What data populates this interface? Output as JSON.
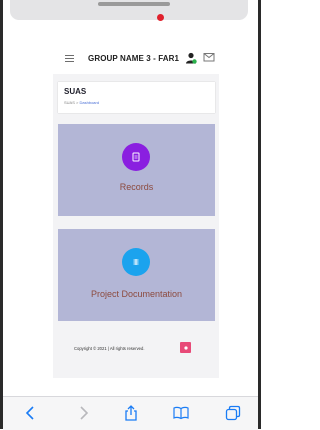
{
  "topbar": {
    "group_name": "GROUP NAME 3 -  FAR1"
  },
  "header": {
    "app_title": "SUAS",
    "breadcrumb_root": "SUAS",
    "breadcrumb_separator": ">",
    "breadcrumb_current": "Dashboard"
  },
  "tiles": [
    {
      "label": "Records",
      "icon": "document-icon",
      "color": "#8a1fe0"
    },
    {
      "label": "Project Documentation",
      "icon": "list-icon",
      "color": "#1ba3ee"
    }
  ],
  "footer": {
    "copyright": "Copyright © 2021 | All rights reserved."
  },
  "toolbar": {
    "icons": [
      "back-icon",
      "forward-icon",
      "share-icon",
      "bookmarks-icon",
      "tabs-icon"
    ]
  },
  "colors": {
    "tile_bg": "#b3b6d6",
    "tile_label": "#8c4a3e",
    "notification": "#e0202c",
    "footer_button": "#e84a78",
    "ios_blue": "#1a7cf5"
  }
}
